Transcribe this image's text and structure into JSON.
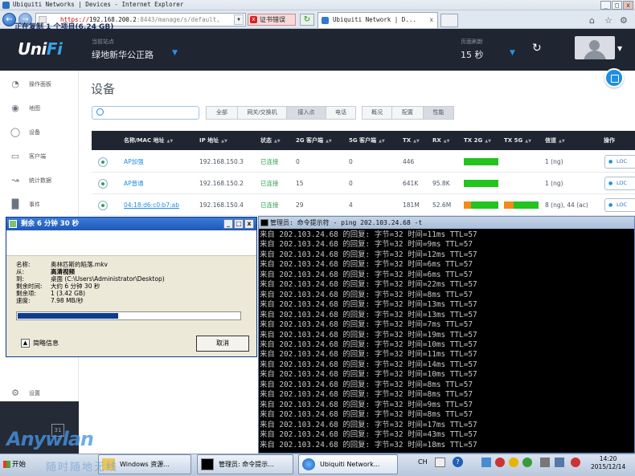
{
  "ie": {
    "title": "Ubiquiti Networks | Devices - Internet Explorer",
    "url_proto": "https://",
    "url_host": "192.168.200.2",
    "url_path": ":8443/manage/s/default,",
    "cert_error": "证书错误",
    "tab_label": "Ubiquiti Network | D...",
    "tab_close": "x"
  },
  "unifi": {
    "logo_a": "Uni",
    "logo_b": "Fi",
    "site_caption": "当前站点",
    "site_value": "绿地新华公正路",
    "refresh_caption": "页面刷新",
    "refresh_value": "15 秒"
  },
  "sidebar": {
    "items": [
      {
        "label": "操作面板",
        "icon": "dashboard-icon"
      },
      {
        "label": "地图",
        "icon": "map-pin-icon"
      },
      {
        "label": "设备",
        "icon": "devices-icon"
      },
      {
        "label": "客户端",
        "icon": "clients-icon"
      },
      {
        "label": "统计数据",
        "icon": "stats-icon"
      },
      {
        "label": "事件",
        "icon": "events-icon"
      }
    ],
    "settings_label": "设置"
  },
  "page": {
    "title": "设备",
    "filters": [
      "全部",
      "网关/交换机",
      "接入点",
      "电话"
    ],
    "views": [
      "概况",
      "配置",
      "性能"
    ]
  },
  "table": {
    "headers": [
      "名称/MAC 地址",
      "IP 地址",
      "状态",
      "2G 客户端",
      "5G 客户端",
      "TX",
      "RX",
      "TX 2G",
      "TX 5G",
      "信道",
      "操作"
    ],
    "action_label": "LOC",
    "rows": [
      {
        "name": "AP加强",
        "ip": "192.168.150.3",
        "status": "已连接",
        "c2g": "0",
        "c5g": "0",
        "tx": "446",
        "rx": "",
        "tx2g": {
          "green": 1.0,
          "orange": 0
        },
        "tx5g": null,
        "channel": "1 (ng)"
      },
      {
        "name": "AP普通",
        "ip": "192.168.150.2",
        "status": "已连接",
        "c2g": "15",
        "c5g": "0",
        "tx": "641K",
        "rx": "95.8K",
        "tx2g": {
          "green": 1.0,
          "orange": 0
        },
        "tx5g": null,
        "channel": "1 (ng)"
      },
      {
        "name": "04:18:d6:c0:b7:ab",
        "ip": "192.168.150.4",
        "status": "已连接",
        "c2g": "29",
        "c5g": "4",
        "tx": "181M",
        "rx": "52.6M",
        "tx2g": {
          "green": 0.78,
          "orange": 0.22
        },
        "tx5g": {
          "green": 0.72,
          "orange": 0.28
        },
        "channel": "8 (ng), 44 (ac)"
      }
    ]
  },
  "copy_dialog": {
    "title": "剩余 6 分钟 30 秒",
    "heading": "正在复制 1 个项目(6.24 GB)",
    "fields": [
      {
        "label": "名称:",
        "value": "奥林匹斯的陷落.mkv"
      },
      {
        "label": "从:",
        "value": "高清视频"
      },
      {
        "label": "到:",
        "value": "桌面 (C:\\Users\\Administrator\\Desktop)"
      },
      {
        "label": "剩余时间:",
        "value": "大约 6 分钟 30 秒"
      },
      {
        "label": "剩余项:",
        "value": "1 (3.42 GB)"
      },
      {
        "label": "速度:",
        "value": "7.98 MB/秒"
      }
    ],
    "progress": 0.45,
    "more_info": "简略信息",
    "cancel": "取消"
  },
  "cmd": {
    "title": "管理员: 命令提示符 - ping  202.103.24.68 -t",
    "host": "202.103.24.68",
    "prefix": "来自",
    "mid": "的回复: 字节=32 时间=",
    "ttl": "TTL=57",
    "times": [
      "11ms",
      "9ms",
      "12ms",
      "6ms",
      "6ms",
      "22ms",
      "8ms",
      "13ms",
      "13ms",
      "7ms",
      "19ms",
      "10ms",
      "11ms",
      "14ms",
      "10ms",
      "8ms",
      "8ms",
      "9ms",
      "8ms",
      "17ms",
      "43ms",
      "18ms"
    ]
  },
  "taskbar": {
    "start": "开始",
    "tasks": [
      "Windows 资源...",
      "管理员: 命令提示...",
      "Ubiquiti Network..."
    ],
    "ime": "CH",
    "time": "14:20",
    "date": "2015/12/14"
  },
  "watermark": {
    "brand": "Anywlan",
    "slogan": "随时随地无线"
  },
  "colors": {
    "accent": "#1f8fdf",
    "ok": "#2ea44f",
    "bar_green": "#22c41e",
    "bar_orange": "#f18a18",
    "topbar": "#1f2531"
  }
}
